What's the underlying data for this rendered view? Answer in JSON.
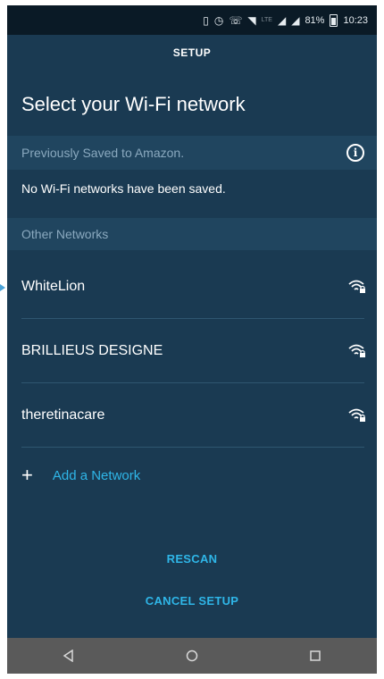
{
  "status_bar": {
    "battery": "81%",
    "time": "10:23",
    "lte": "LTE"
  },
  "header": {
    "title": "SETUP"
  },
  "heading": "Select your Wi-Fi network",
  "saved_section": {
    "label": "Previously Saved to Amazon.",
    "empty_message": "No Wi-Fi networks have been saved."
  },
  "other_section": {
    "label": "Other Networks"
  },
  "networks": [
    {
      "name": "WhiteLion",
      "icon": "wifi-lock-icon"
    },
    {
      "name": "BRILLIEUS DESIGNE",
      "icon": "wifi-lock-icon"
    },
    {
      "name": "theretinacare",
      "icon": "wifi-lock-icon"
    }
  ],
  "add_network": {
    "icon": "plus",
    "label": "Add a Network"
  },
  "actions": {
    "rescan": "RESCAN",
    "cancel": "CANCEL SETUP"
  },
  "colors": {
    "background": "#1a3a52",
    "section_band": "#20455f",
    "accent": "#2fb6e8",
    "navbar": "#5a5a5a"
  }
}
